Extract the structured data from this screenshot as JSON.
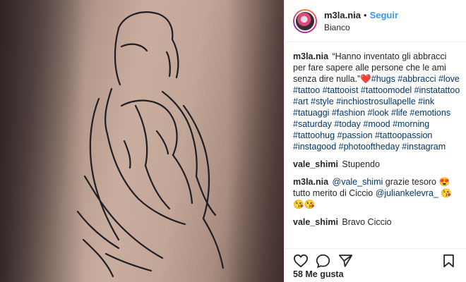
{
  "post": {
    "author": "m3la.nia",
    "separator": "•",
    "follow_label": "Seguir",
    "location": "Bianco"
  },
  "caption": {
    "user": "m3la.nia",
    "text": "“Hanno inventato gli abbracci per fare sapere alle persone che le ami senza dire nulla.”",
    "heart": "❤️",
    "hashtags": "#hugs #abbracci #love #tattoo #tattooist #tattoomodel #instatattoo #art #style #inchiostrosullapelle #ink #tatuaggi #fashion #look #life #emotions #saturday #today #mood #morning #tattoohug #passion #tattoopassion #instagood #photooftheday #instagram"
  },
  "comments": [
    {
      "user": "vale_shimi",
      "text": "Stupendo"
    },
    {
      "user": "m3la.nia",
      "mention1": "@vale_shimi",
      "text1": "grazie tesoro 😍tutto merito di Ciccio",
      "mention2": "@juliankelevra_",
      "text2": "😘😘😘"
    },
    {
      "user": "vale_shimi",
      "text": "Bravo Ciccio"
    }
  ],
  "likes": "58 Me gusta",
  "icons": [
    "heart-icon",
    "comment-icon",
    "share-icon",
    "bookmark-icon"
  ]
}
